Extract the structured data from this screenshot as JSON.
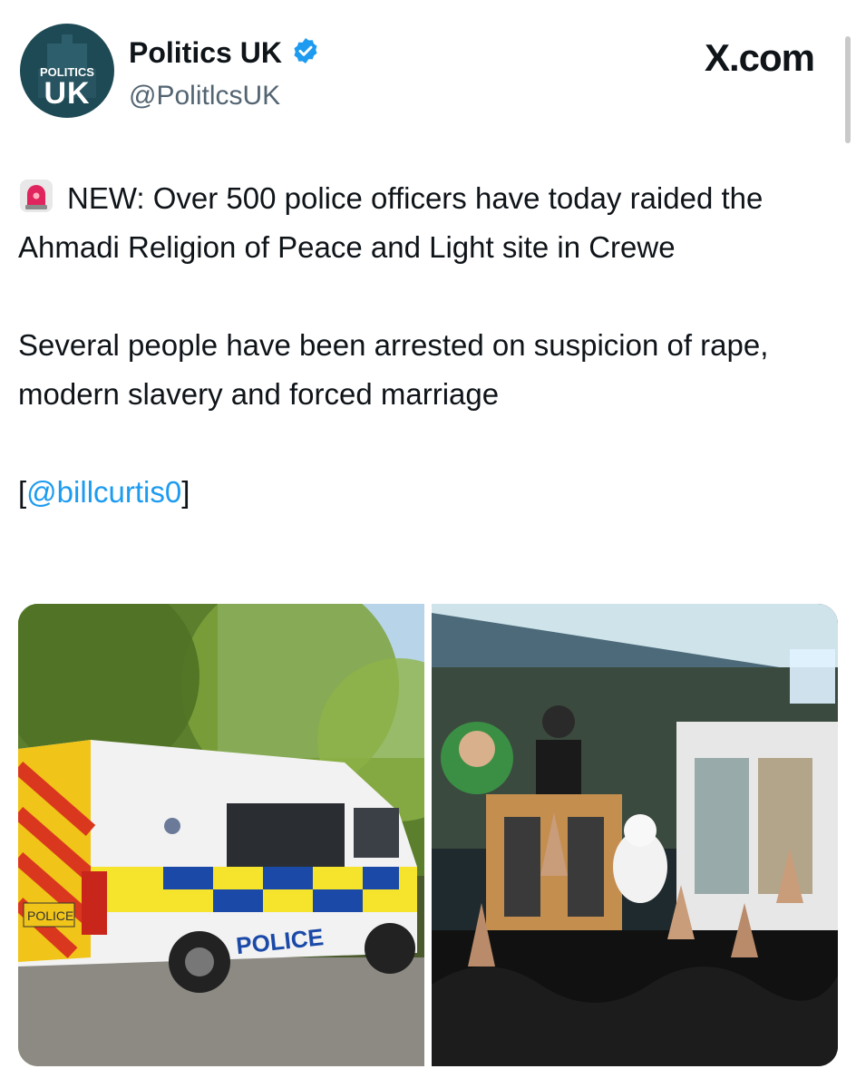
{
  "header": {
    "avatar_text_top": "POLITICS",
    "avatar_text_main": "UK",
    "display_name": "Politics UK",
    "handle": "@PolitlcsUK",
    "site_label": "X.com"
  },
  "tweet": {
    "paragraph_1": "NEW: Over 500 police officers have today raided the Ahmadi Religion of Peace and Light site in Crewe",
    "paragraph_2": "Several people have been arrested on suspicion of rape, modern slavery and forced marriage",
    "mention_open": "[",
    "mention": "@billcurtis0",
    "mention_close": "]"
  },
  "media": {
    "left_photo": {
      "description_icon": "police-van-photo",
      "van_side_text": "POLICE",
      "van_rear_text": "POLICE"
    },
    "right_photo": {
      "description_icon": "gathering-photo"
    }
  },
  "colors": {
    "accent": "#1d9bf0",
    "text": "#0f1419",
    "secondary": "#536471",
    "avatar_bg": "#1e4a55"
  }
}
